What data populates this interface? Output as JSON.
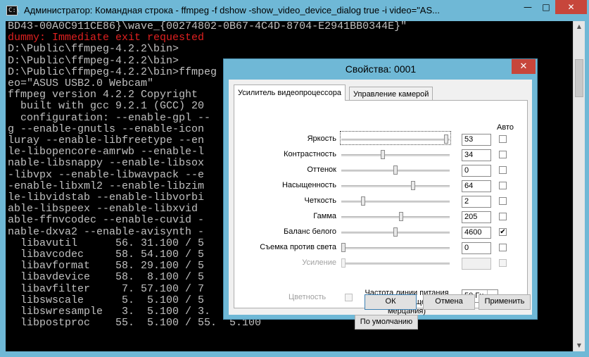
{
  "console": {
    "title": "Администратор: Командная строка - ffmpeg  -f dshow -show_video_device_dialog true -i video=\"AS...",
    "minimize_glyph": "—",
    "maximize_glyph": "□",
    "close_glyph": "✕",
    "icon_glyph": "C:\\",
    "lines": [
      {
        "text": "BD43-00A0C911CE86}\\wave_{00274802-0B67-4C4D-8704-E2941BB0344E}\"",
        "color": "default"
      },
      {
        "text": "dummy: Immediate exit requested",
        "color": "red"
      },
      {
        "text": "",
        "color": "default"
      },
      {
        "text": "D:\\Public\\ffmpeg-4.2.2\\bin>",
        "color": "default"
      },
      {
        "text": "D:\\Public\\ffmpeg-4.2.2\\bin>",
        "color": "default"
      },
      {
        "text": "D:\\Public\\ffmpeg-4.2.2\\bin>ffmpeg                                        vid",
        "color": "default"
      },
      {
        "text": "eo=\"ASUS USB2.0 Webcam\"",
        "color": "default"
      },
      {
        "text": "ffmpeg version 4.2.2 Copyright",
        "color": "default"
      },
      {
        "text": "  built with gcc 9.2.1 (GCC) 20",
        "color": "default"
      },
      {
        "text": "  configuration: --enable-gpl --                                         onfig",
        "color": "default"
      },
      {
        "text": "g --enable-gnutls --enable-icon                                     --enable-libb",
        "color": "default"
      },
      {
        "text": "luray --enable-libfreetype --en                                    --enable",
        "color": "default"
      },
      {
        "text": "le-libopencore-amrwb --enable-l                                    e --enable",
        "color": "default"
      },
      {
        "text": "nable-libsnappy --enable-libsox                                    --enable-",
        "color": "default"
      },
      {
        "text": "-libvpx --enable-libwavpack --e                                    265 --enable",
        "color": "default"
      },
      {
        "text": "-enable-libxml2 --enable-libzim                                     --enable",
        "color": "default"
      },
      {
        "text": "le-libvidstab --enable-libvorbi                                     --enable",
        "color": "default"
      },
      {
        "text": "able-libspeex --enable-libxvid                                      --enable",
        "color": "default"
      },
      {
        "text": "able-ffnvcodec --enable-cuvid -                                     --enable",
        "color": "default"
      },
      {
        "text": "nable-dxva2 --enable-avisynth -",
        "color": "default"
      },
      {
        "text": "  libavutil      56. 31.100 / 5",
        "color": "default"
      },
      {
        "text": "  libavcodec     58. 54.100 / 5",
        "color": "default"
      },
      {
        "text": "  libavformat    58. 29.100 / 5",
        "color": "default"
      },
      {
        "text": "  libavdevice    58.  8.100 / 5",
        "color": "default"
      },
      {
        "text": "  libavfilter     7. 57.100 / 7",
        "color": "default"
      },
      {
        "text": "  libswscale      5.  5.100 / 5",
        "color": "default"
      },
      {
        "text": "  libswresample   3.  5.100 / 3.   5.100",
        "color": "default"
      },
      {
        "text": "  libpostproc    55.  5.100 / 55.  5.100",
        "color": "default"
      }
    ],
    "scroll_up_glyph": "▲",
    "scroll_down_glyph": "▼"
  },
  "dialog": {
    "title": "Свойства: 0001",
    "close_glyph": "✕",
    "tabs": [
      "Усилитель видеопроцессора",
      "Управление камерой"
    ],
    "auto_header": "Авто",
    "properties": [
      {
        "label": "Яркость",
        "value": "53",
        "level": 0.97,
        "auto": false,
        "disabled": false
      },
      {
        "label": "Контрастность",
        "value": "34",
        "level": 0.38,
        "auto": false,
        "disabled": false
      },
      {
        "label": "Оттенок",
        "value": "0",
        "level": 0.5,
        "auto": false,
        "disabled": false
      },
      {
        "label": "Насыщенность",
        "value": "64",
        "level": 0.66,
        "auto": false,
        "disabled": false
      },
      {
        "label": "Четкость",
        "value": "2",
        "level": 0.2,
        "auto": false,
        "disabled": false
      },
      {
        "label": "Гамма",
        "value": "205",
        "level": 0.55,
        "auto": false,
        "disabled": false
      },
      {
        "label": "Баланс белого",
        "value": "4600",
        "level": 0.5,
        "auto": true,
        "disabled": false
      },
      {
        "label": "Съемка против света",
        "value": "0",
        "level": 0.02,
        "auto": false,
        "disabled": false
      },
      {
        "label": "Усиление",
        "value": "",
        "level": 0.02,
        "auto": false,
        "disabled": true
      }
    ],
    "color_label": "Цветность",
    "power_label": "Частота линии питания (предотвращение мерцания)",
    "power_value": "50 Гц",
    "dropdown_glyph": "▼",
    "check_glyph": "✔",
    "defaults_label": "По умолчанию",
    "ok_label": "ОК",
    "cancel_label": "Отмена",
    "apply_label": "Применить"
  }
}
